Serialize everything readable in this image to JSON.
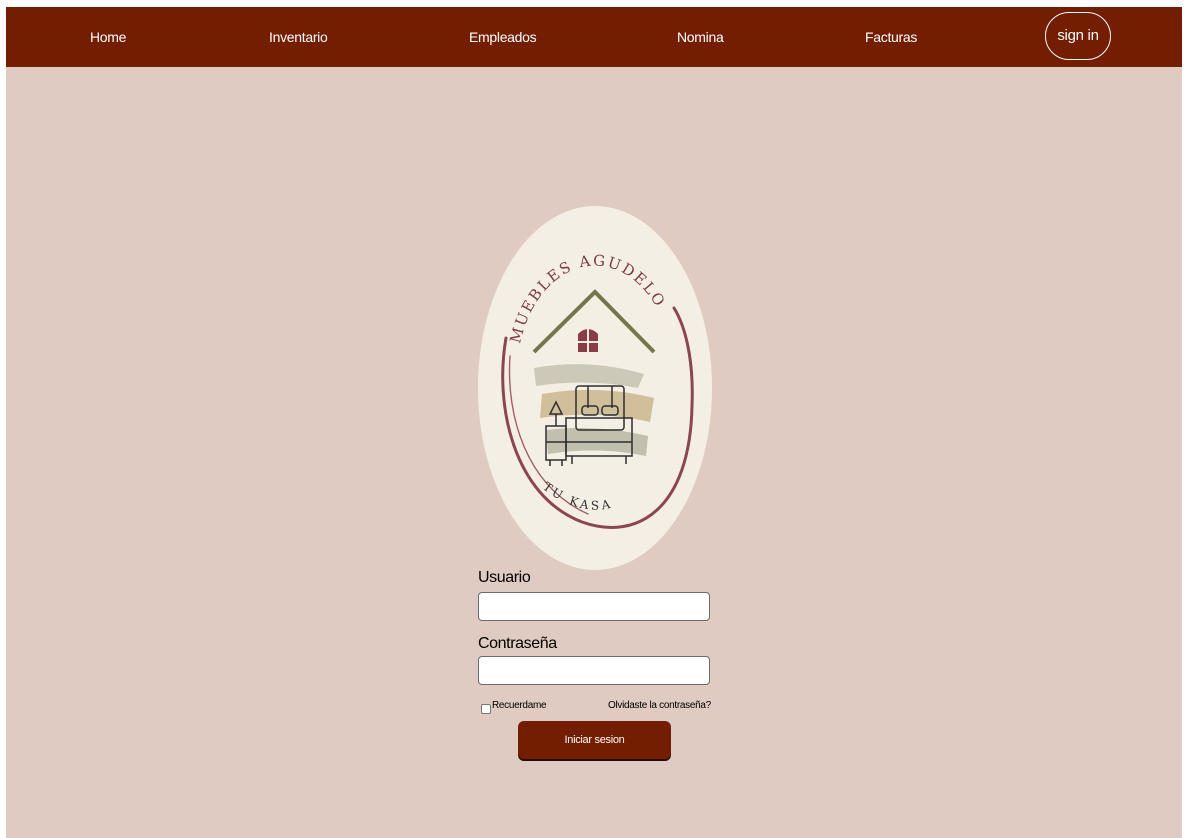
{
  "colors": {
    "nav_background": "#731e00",
    "page_background": "#dfcbc1",
    "logo_background": "#f4efe4",
    "button_background": "#731e00"
  },
  "nav": {
    "items": [
      {
        "label": "Home"
      },
      {
        "label": "Inventario"
      },
      {
        "label": "Empleados"
      },
      {
        "label": "Nomina"
      },
      {
        "label": "Facturas"
      }
    ],
    "signin_label": "sign in"
  },
  "logo": {
    "top_text": "MUEBLES AGUDELO",
    "bottom_text": "TU KASA",
    "icons": [
      "house-roof-icon",
      "window-icon",
      "bed-icon",
      "nightstand-lamp-icon"
    ]
  },
  "form": {
    "username_label": "Usuario",
    "username_value": "",
    "password_label": "Contraseña",
    "password_value": "",
    "remember_label": "Recuerdame",
    "remember_checked": false,
    "forgot_label": "Olvidaste la contraseña?",
    "submit_label": "Iniciar sesion"
  }
}
